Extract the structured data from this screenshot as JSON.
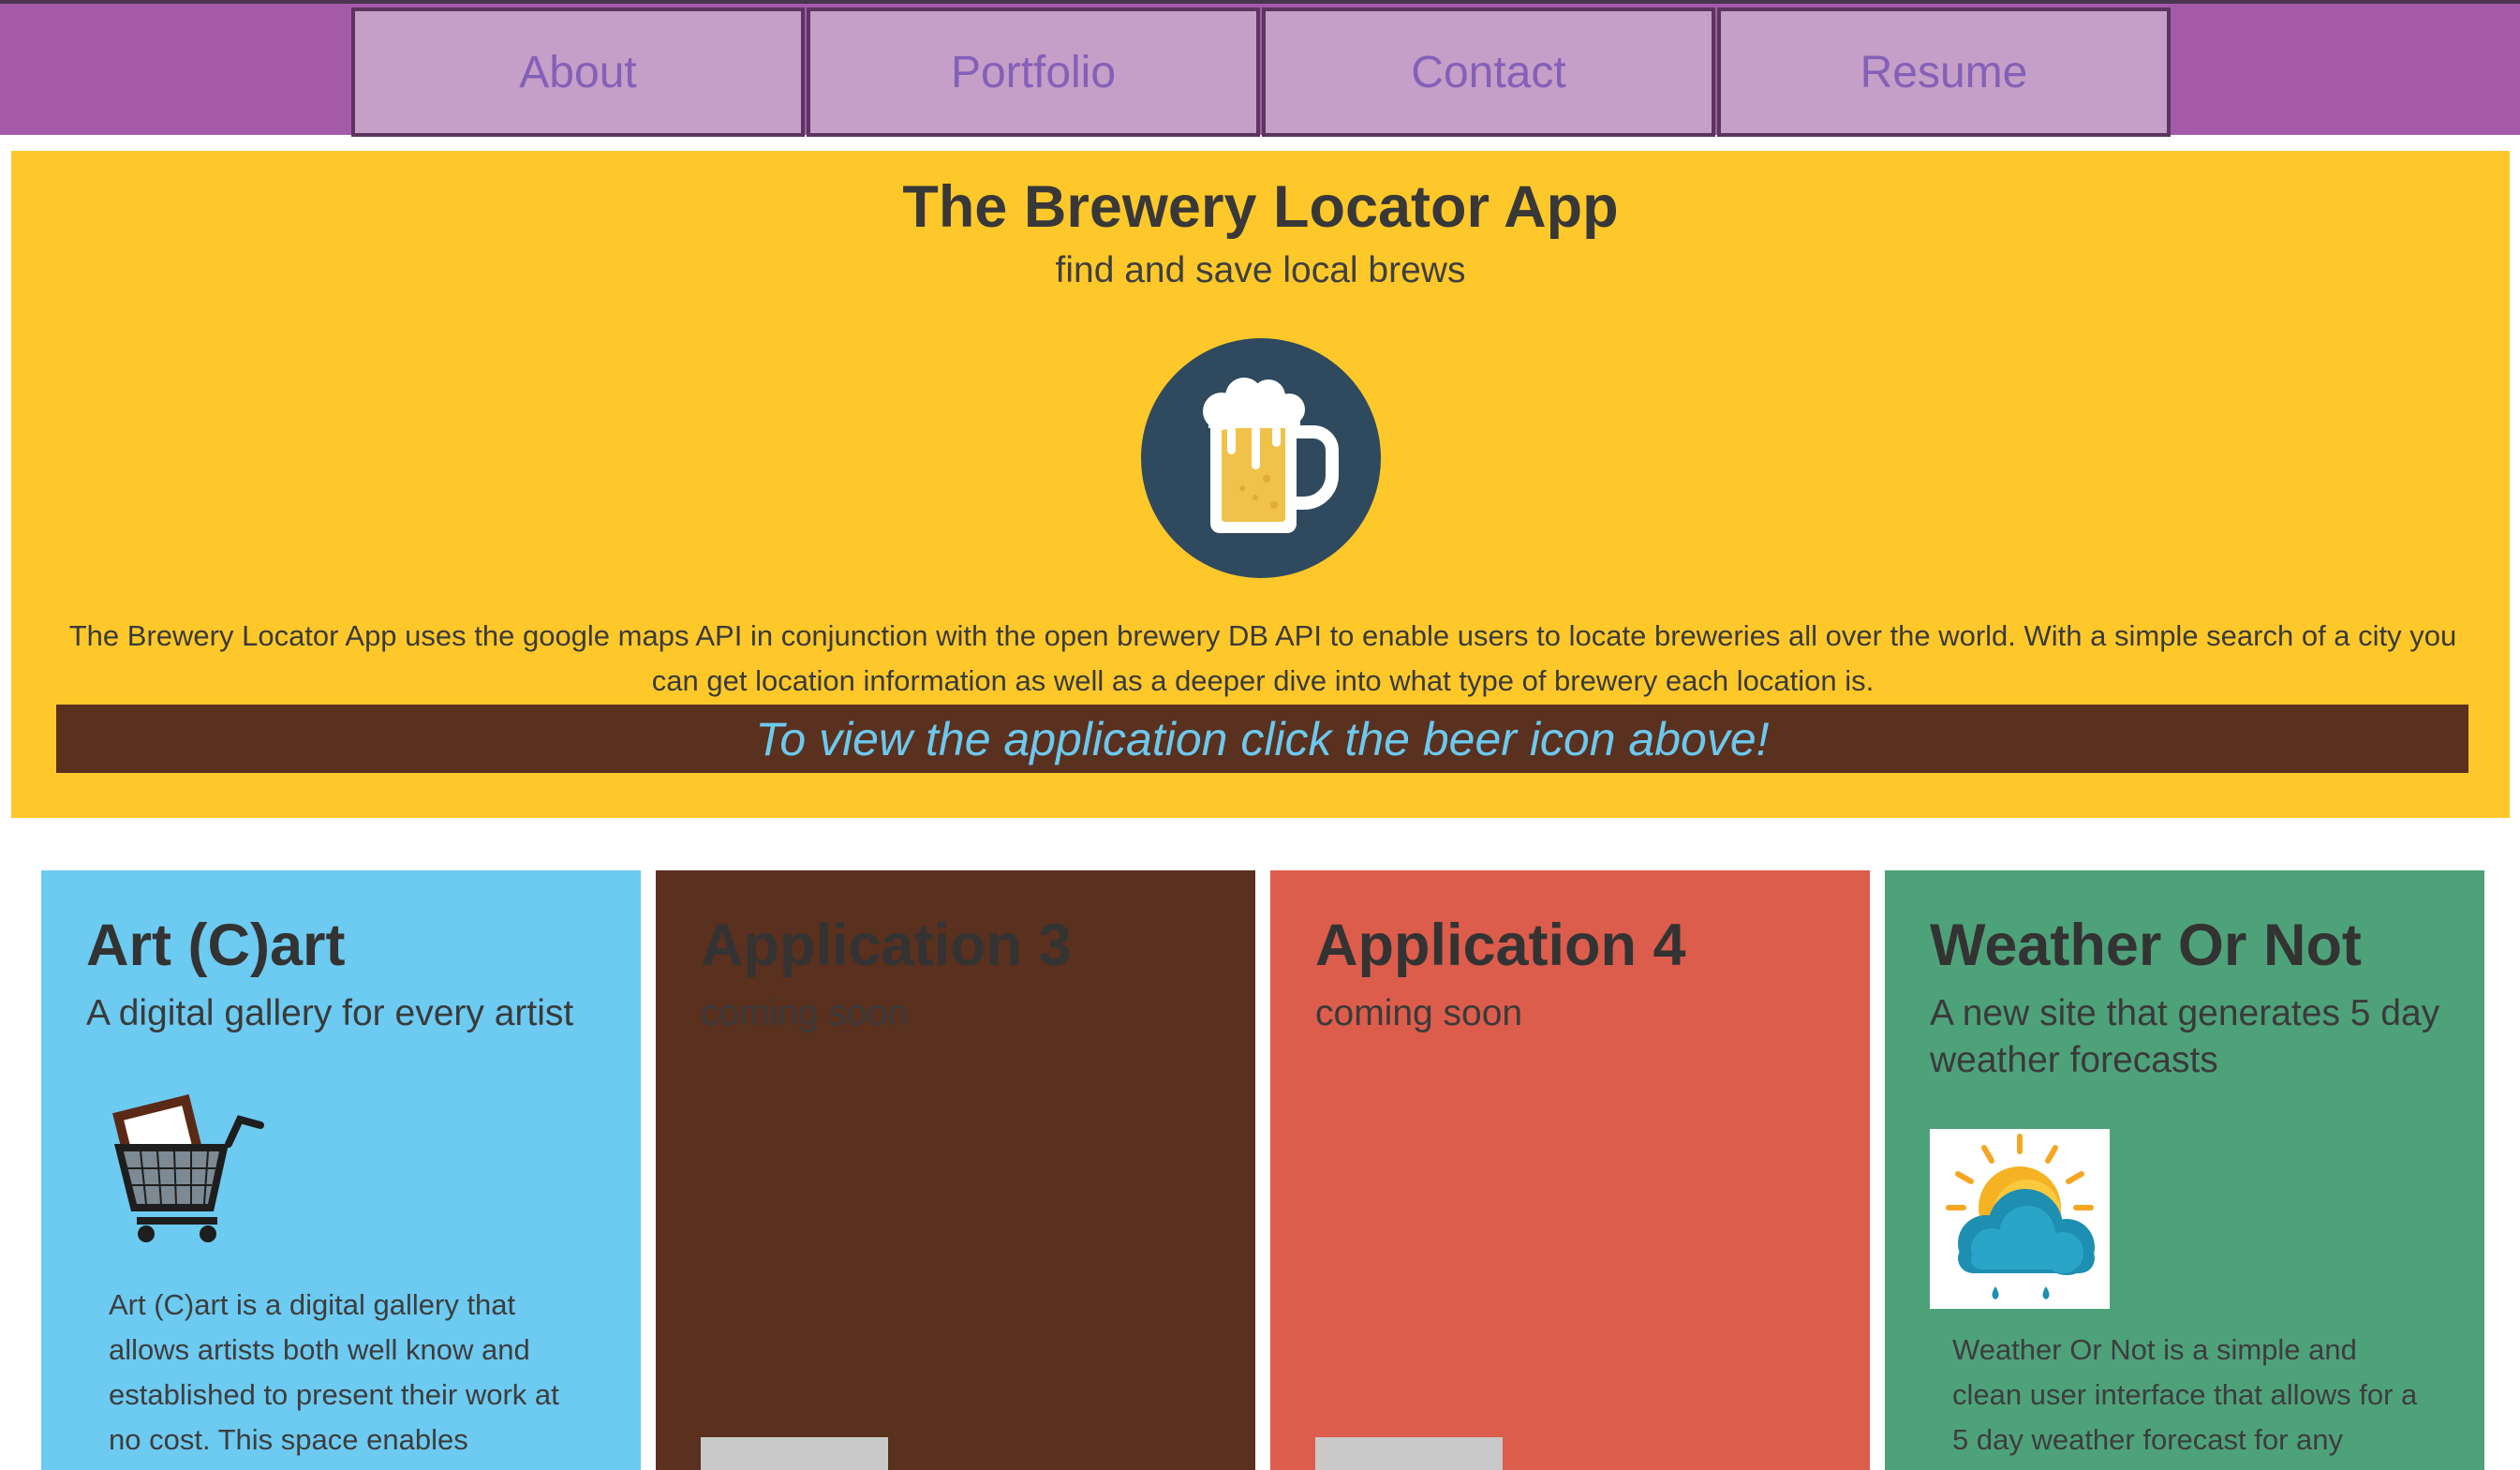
{
  "nav": {
    "items": [
      {
        "label": "About"
      },
      {
        "label": "Portfolio"
      },
      {
        "label": "Contact"
      },
      {
        "label": "Resume"
      }
    ]
  },
  "featured": {
    "title": "The Brewery Locator App",
    "subtitle": "find and save local brews",
    "icon": "beer-mug-icon",
    "description": "The Brewery Locator App uses the google maps API in conjunction with the open brewery DB API to enable users to locate breweries all over the world. With a simple search of a city you can get location information as well as a deeper dive into what type of brewery each location is.",
    "cta": "To view the application click the beer icon above!"
  },
  "cards": [
    {
      "title": "Art (C)art",
      "subtitle": "A digital gallery for every artist",
      "icon": "shopping-cart-art-icon",
      "description": "Art (C)art is a digital gallery that allows artists both well know and established to present their work at no cost. This space enables",
      "color": "#6dcaf0"
    },
    {
      "title": "Application 3",
      "subtitle": "coming soon",
      "color": "#5a301f"
    },
    {
      "title": "Application 4",
      "subtitle": "coming soon",
      "color": "#dc5d4c"
    },
    {
      "title": "Weather Or Not",
      "subtitle": "A new site that generates 5 day weather forecasts",
      "icon": "sun-rain-cloud-icon",
      "description": "Weather Or Not is a simple and clean user interface that allows for a 5 day weather forecast for any",
      "color": "#4ea27a"
    }
  ],
  "colors": {
    "nav_bg": "#a45aa8",
    "nav_button": "#c59fc7",
    "nav_text": "#8460b8",
    "featured_bg": "#ffc82a",
    "cta_bg": "#5a301f",
    "cta_text": "#6cc9ee"
  }
}
